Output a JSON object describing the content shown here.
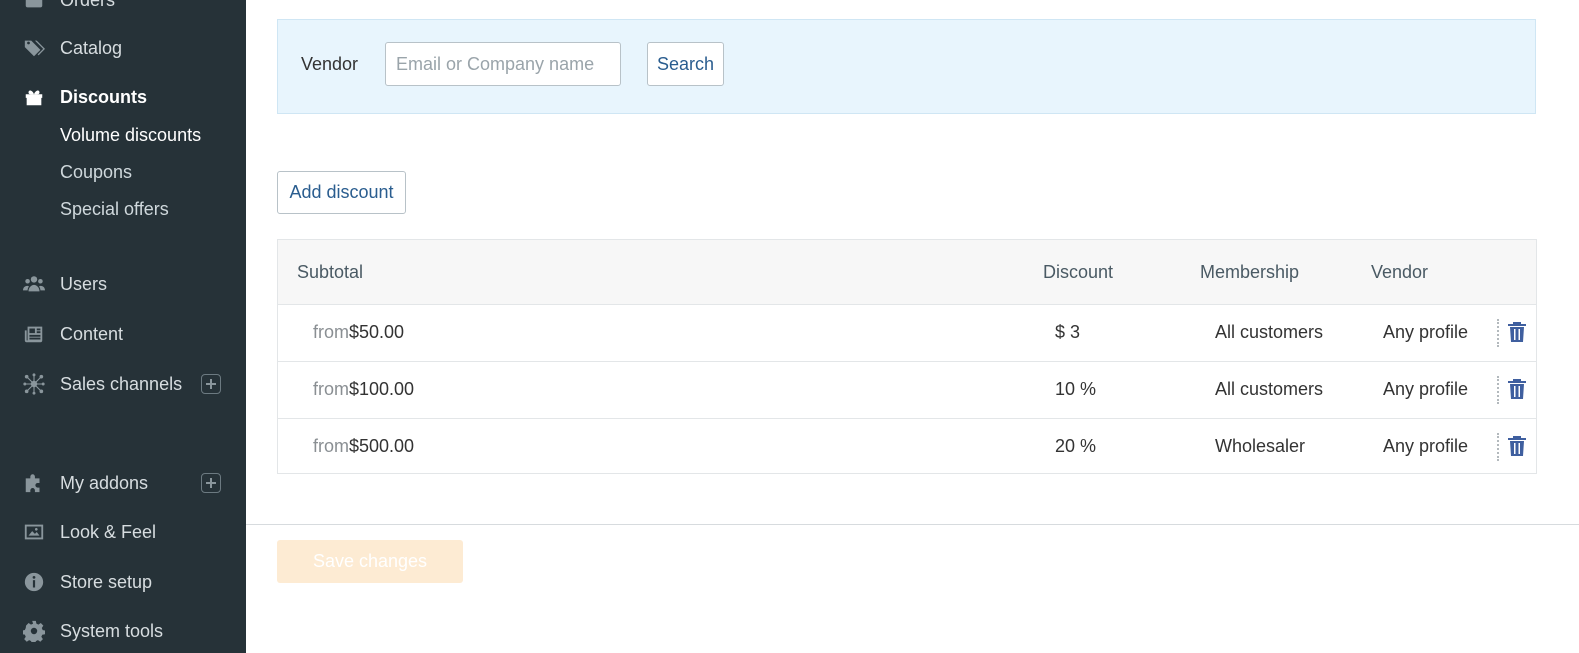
{
  "sidebar": {
    "items": [
      {
        "label": "Orders",
        "icon": "box-icon"
      },
      {
        "label": "Catalog",
        "icon": "tags-icon"
      },
      {
        "label": "Discounts",
        "icon": "gift-icon"
      },
      {
        "label": "Users",
        "icon": "users-icon"
      },
      {
        "label": "Content",
        "icon": "newspaper-icon"
      },
      {
        "label": "Sales channels",
        "icon": "network-icon"
      },
      {
        "label": "My addons",
        "icon": "puzzle-icon"
      },
      {
        "label": "Look & Feel",
        "icon": "image-icon"
      },
      {
        "label": "Store setup",
        "icon": "info-icon"
      },
      {
        "label": "System tools",
        "icon": "gear-icon"
      }
    ],
    "discount_subitems": [
      "Volume discounts",
      "Coupons",
      "Special offers"
    ]
  },
  "search": {
    "vendor_label": "Vendor",
    "placeholder": "Email or Company name",
    "value": "",
    "button_label": "Search"
  },
  "actions": {
    "add_discount_label": "Add discount",
    "save_label": "Save changes"
  },
  "table": {
    "headers": [
      "Subtotal",
      "Discount",
      "Membership",
      "Vendor"
    ],
    "from_prefix": "from",
    "rows": [
      {
        "subtotal": "$50.00",
        "discount": "$ 3",
        "membership": "All customers",
        "vendor": "Any profile"
      },
      {
        "subtotal": "$100.00",
        "discount": "10 %",
        "membership": "All customers",
        "vendor": "Any profile"
      },
      {
        "subtotal": "$500.00",
        "discount": "20 %",
        "membership": "Wholesaler",
        "vendor": "Any profile"
      }
    ]
  },
  "colors": {
    "sidebar_bg": "#263238",
    "panel_bg": "#e8f5fd",
    "link": "#2a5d8f",
    "save_disabled": "#fdebd3",
    "trash": "#3f5f9f"
  }
}
